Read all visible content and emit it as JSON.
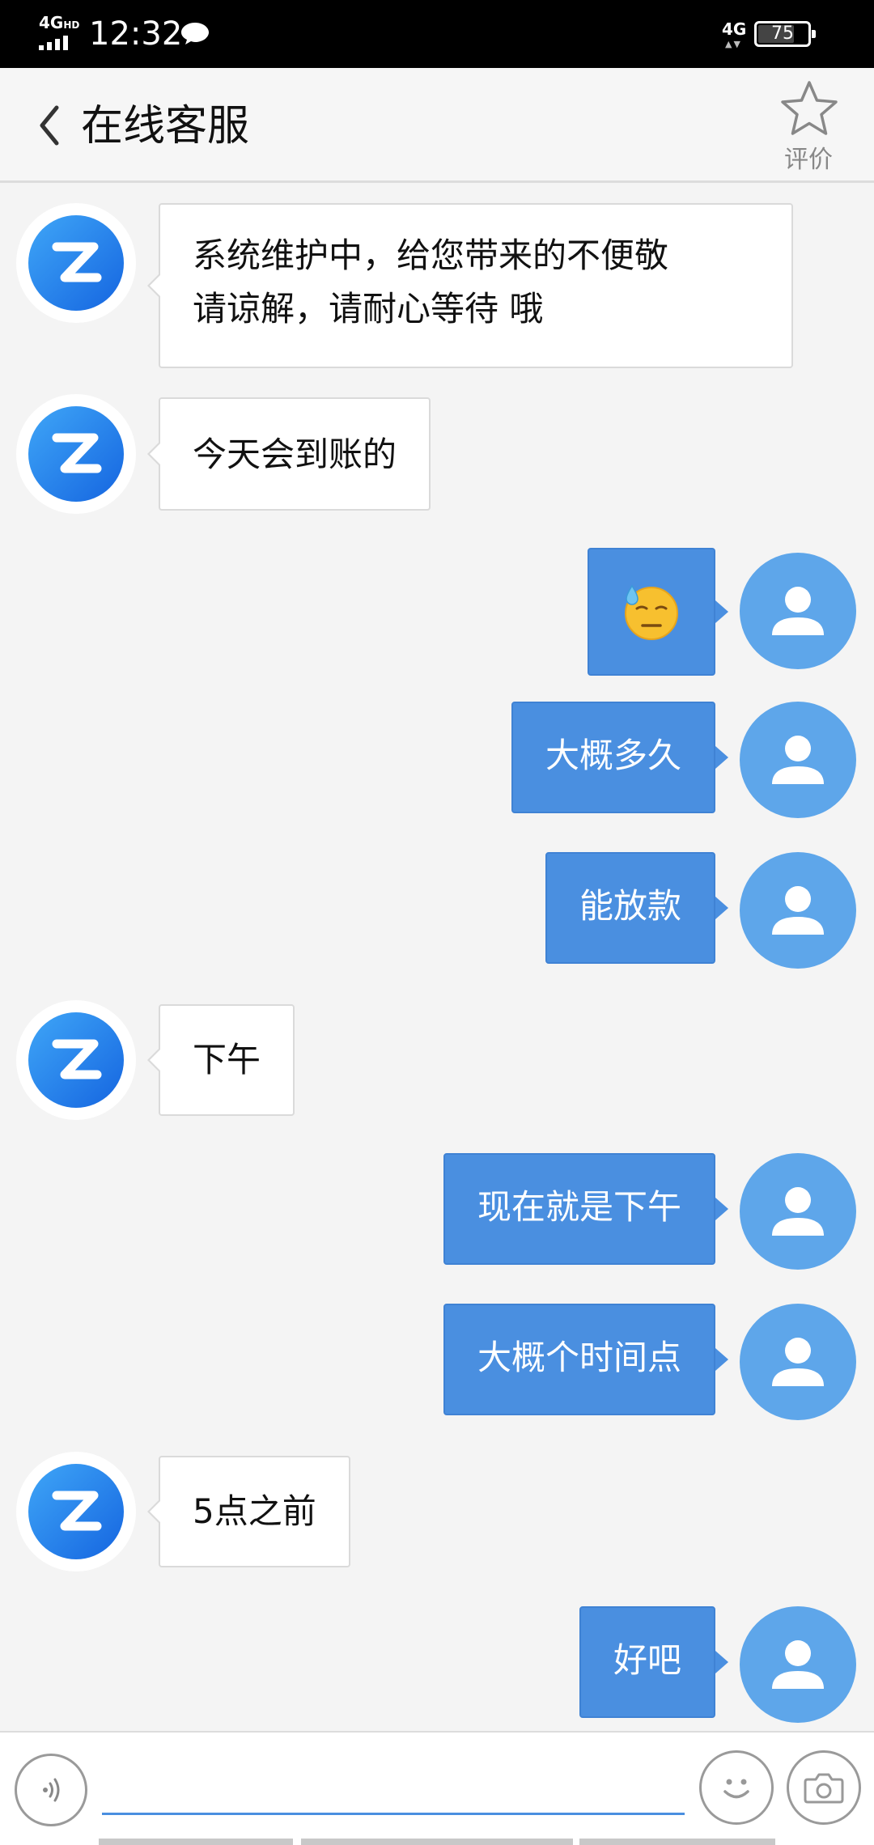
{
  "status_bar": {
    "network_left": "4G",
    "network_left_hd": "HD",
    "time": "12:32",
    "network_right": "4G",
    "battery_level": "75"
  },
  "header": {
    "title": "在线客服",
    "rate_label": "评价"
  },
  "messages": [
    {
      "sender": "agent",
      "lines": [
        "系统维护中，给您带来的不便敬",
        "请谅解，请耐心等待 哦"
      ]
    },
    {
      "sender": "agent",
      "text": "今天会到账的"
    },
    {
      "sender": "user",
      "emoji": "sweat-face"
    },
    {
      "sender": "user",
      "text": "大概多久"
    },
    {
      "sender": "user",
      "text": "能放款"
    },
    {
      "sender": "agent",
      "text": "下午"
    },
    {
      "sender": "user",
      "text": "现在就是下午"
    },
    {
      "sender": "user",
      "text": "大概个时间点"
    },
    {
      "sender": "agent",
      "text": "5点之前"
    },
    {
      "sender": "user",
      "text": "好吧"
    }
  ],
  "input": {
    "value": "",
    "placeholder": ""
  },
  "colors": {
    "user_bubble": "#4a8fe0",
    "agent_bubble": "#ffffff",
    "user_avatar": "#5ea6ea",
    "agent_avatar_start": "#3fa6f7",
    "agent_avatar_end": "#1565e0"
  },
  "icons": {
    "back": "chevron-left-icon",
    "rate": "star-icon",
    "voice": "voice-icon",
    "emoji": "smile-icon",
    "camera": "camera-icon",
    "agent_avatar": "z-logo-icon",
    "user_avatar": "person-icon"
  }
}
